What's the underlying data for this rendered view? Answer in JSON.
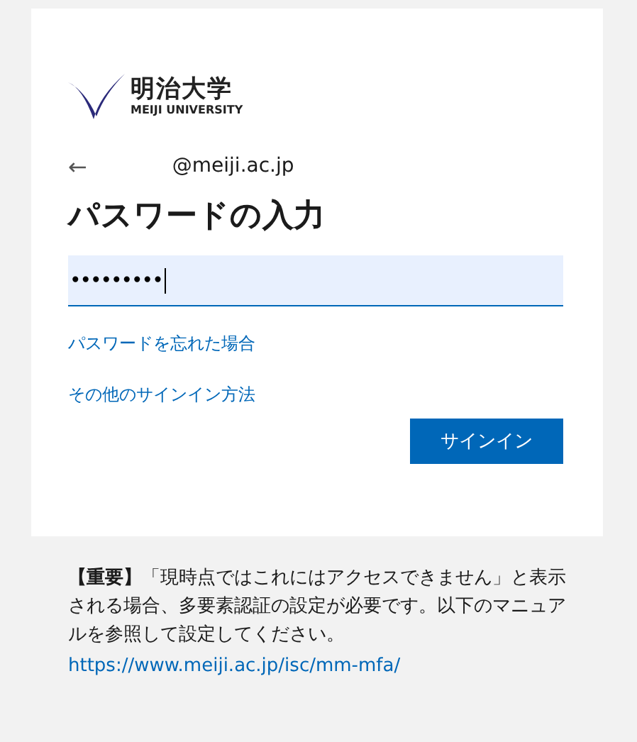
{
  "logo": {
    "name_ja": "明治大学",
    "name_en": "MEIJI UNIVERSITY"
  },
  "identity": {
    "back": "←",
    "email": "@meiji.ac.jp"
  },
  "title": "パスワードの入力",
  "password": {
    "value": "•••••••••",
    "focused": true
  },
  "links": [
    "パスワードを忘れた場合",
    "その他のサインイン方法"
  ],
  "button": "サインイン",
  "notice": {
    "text": "**【重要】**「現時点ではこれにはアクセスできません」と表示される場合、多要素認証の設定が必要です。以下のマニュアルを参照して設定してください。",
    "link": "https://www.meiji.ac.jp/isc/mm-mfa/"
  }
}
